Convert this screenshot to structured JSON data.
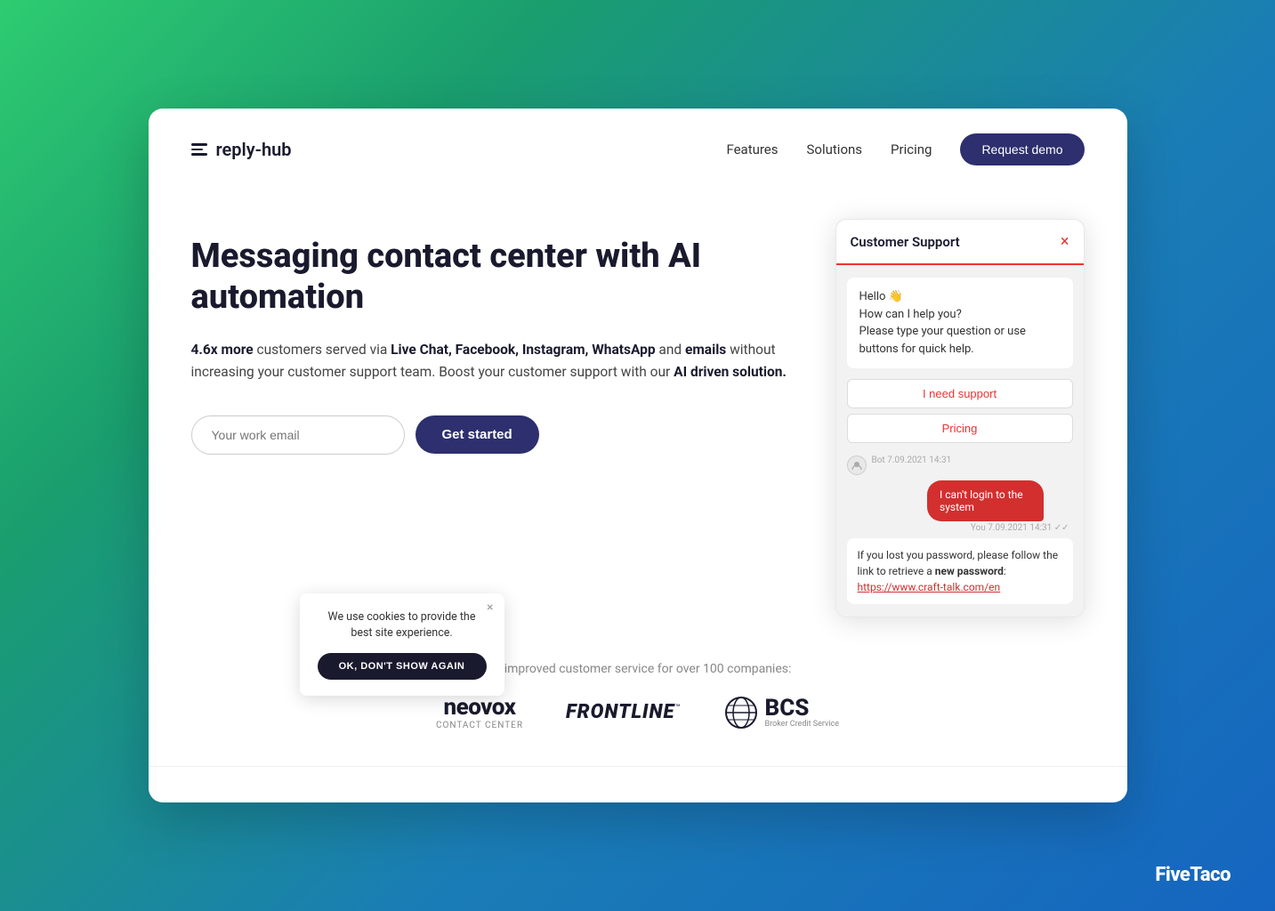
{
  "brand": {
    "name": "reply-hub"
  },
  "nav": {
    "links": [
      "Features",
      "Solutions",
      "Pricing"
    ],
    "cta": "Request demo"
  },
  "hero": {
    "title": "Messaging contact center with AI automation",
    "description_start": "4.6x more",
    "description_middle": " customers served via ",
    "channels": "Live Chat, Facebook, Instagram, WhatsApp",
    "description_end": " and ",
    "emails": "emails",
    "description_tail": " without increasing your customer support team. Boost your customer support with our ",
    "ai": "AI driven solution.",
    "email_placeholder": "Your work email",
    "cta": "Get started"
  },
  "chat_widget": {
    "title": "Customer Support",
    "close_icon": "×",
    "greeting": "Hello 👋\nHow can I help you?\nPlease type your question or use buttons for quick help.",
    "btn_support": "I need support",
    "btn_pricing": "Pricing",
    "bot_label": "Bot 7.09.2021 14:31",
    "user_message": "I can't login to the system",
    "user_time": "You 7.09.2021 14:31 ✓✓",
    "bot_reply": "If you lost you password, please follow the link to retrieve a new password: https://www.craft-talk.com/en"
  },
  "companies": {
    "label": "We improved customer service for over 100 companies:",
    "logos": [
      {
        "name": "neovox",
        "sub": "Contact Center"
      },
      {
        "name": "FRONTLINE",
        "tm": "™"
      },
      {
        "name": "BCS",
        "sub": "Broker Credit Service"
      }
    ]
  },
  "cookie": {
    "text": "We use cookies to provide the best site experience.",
    "btn": "OK, DON'T SHOW AGAIN"
  },
  "watermark": "FiveTaco"
}
